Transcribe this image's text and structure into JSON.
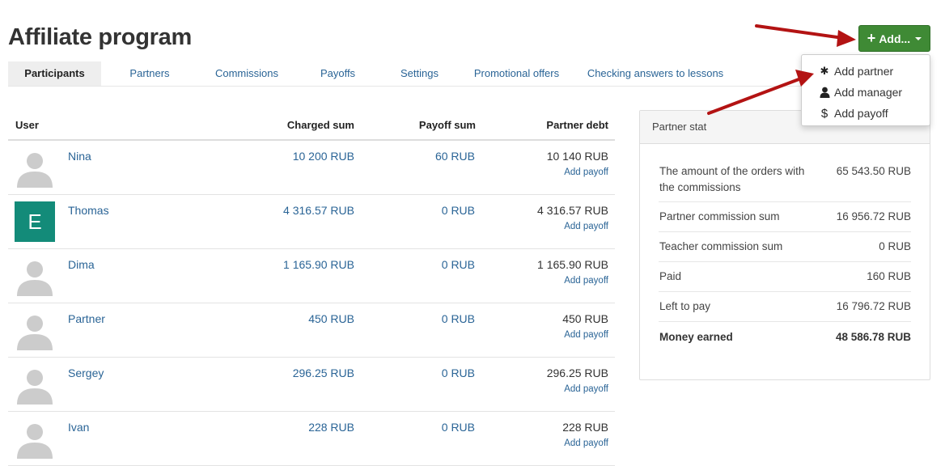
{
  "page": {
    "title": "Affiliate program"
  },
  "add_button": {
    "label": "Add..."
  },
  "tabs": [
    {
      "label": "Participants",
      "active": true
    },
    {
      "label": "Partners"
    },
    {
      "label": "Commissions"
    },
    {
      "label": "Payoffs"
    },
    {
      "label": "Settings"
    },
    {
      "label": "Promotional offers"
    },
    {
      "label": "Checking answers to lessons"
    }
  ],
  "dropdown": {
    "items": [
      {
        "label": "Add partner",
        "icon": "asterisk-icon"
      },
      {
        "label": "Add manager",
        "icon": "user-icon"
      },
      {
        "label": "Add payoff",
        "icon": "dollar-icon"
      }
    ]
  },
  "table": {
    "headers": {
      "user": "User",
      "charged": "Charged sum",
      "payoff": "Payoff sum",
      "debt": "Partner debt"
    },
    "add_payoff_label": "Add payoff",
    "rows": [
      {
        "name": "Nina",
        "charged": "10 200 RUB",
        "payoff": "60 RUB",
        "debt": "10 140 RUB",
        "avatar": "default"
      },
      {
        "name": "Thomas",
        "charged": "4 316.57 RUB",
        "payoff": "0 RUB",
        "debt": "4 316.57 RUB",
        "avatar": "letter",
        "avatar_letter": "E",
        "avatar_color": "#138b79"
      },
      {
        "name": "Dima",
        "charged": "1 165.90 RUB",
        "payoff": "0 RUB",
        "debt": "1 165.90 RUB",
        "avatar": "default"
      },
      {
        "name": "Partner",
        "charged": "450 RUB",
        "payoff": "0 RUB",
        "debt": "450 RUB",
        "avatar": "default"
      },
      {
        "name": "Sergey",
        "charged": "296.25 RUB",
        "payoff": "0 RUB",
        "debt": "296.25 RUB",
        "avatar": "default"
      },
      {
        "name": "Ivan",
        "charged": "228 RUB",
        "payoff": "0 RUB",
        "debt": "228 RUB",
        "avatar": "default"
      }
    ]
  },
  "stat": {
    "title": "Partner stat",
    "rows": [
      {
        "label": "The amount of the orders with the commissions",
        "value": "65 543.50 RUB"
      },
      {
        "label": "Partner commission sum",
        "value": "16 956.72 RUB"
      },
      {
        "label": "Teacher commission sum",
        "value": "0 RUB"
      },
      {
        "label": "Paid",
        "value": "160 RUB"
      },
      {
        "label": "Left to pay",
        "value": "16 796.72 RUB"
      },
      {
        "label": "Money earned",
        "value": "48 586.78 RUB",
        "bold": true
      }
    ]
  },
  "colors": {
    "accent_green": "#3f8a35",
    "link_blue": "#2a6496",
    "annotation_arrow": "#b31313"
  }
}
